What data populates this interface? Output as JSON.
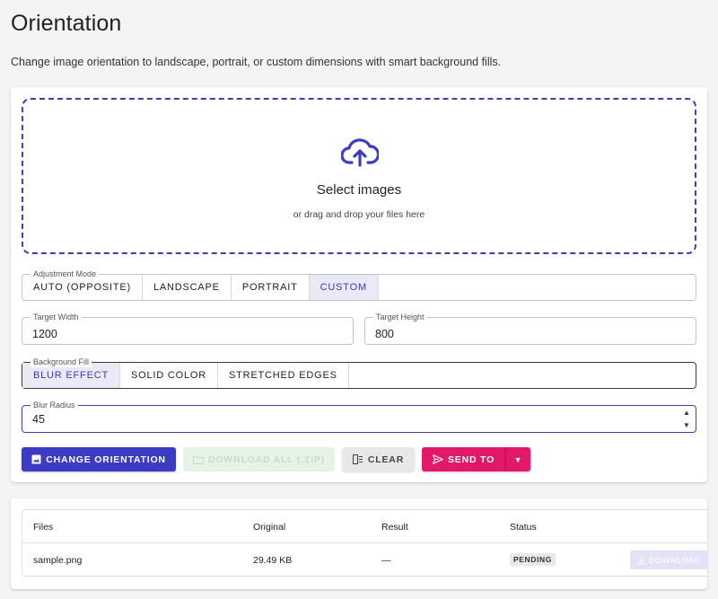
{
  "page": {
    "title": "Orientation",
    "description": "Change image orientation to landscape, portrait, or custom dimensions with smart background fills."
  },
  "dropzone": {
    "title": "Select images",
    "subtitle": "or drag and drop your files here",
    "icon": "cloud-upload-icon"
  },
  "adjustment_mode": {
    "label": "Adjustment Mode",
    "options": [
      "AUTO (OPPOSITE)",
      "LANDSCAPE",
      "PORTRAIT",
      "CUSTOM"
    ],
    "selected": "CUSTOM"
  },
  "target_width": {
    "label": "Target Width",
    "value": "1200"
  },
  "target_height": {
    "label": "Target Height",
    "value": "800"
  },
  "background_fill": {
    "label": "Background Fill",
    "options": [
      "BLUR EFFECT",
      "SOLID COLOR",
      "STRETCHED EDGES"
    ],
    "selected": "BLUR EFFECT"
  },
  "blur_radius": {
    "label": "Blur Radius",
    "value": "45"
  },
  "actions": {
    "change_orientation": "CHANGE ORIENTATION",
    "download_all": "DOWNLOAD ALL (.ZIP)",
    "clear": "CLEAR",
    "send_to": "SEND TO"
  },
  "files_table": {
    "headers": [
      "Files",
      "Original",
      "Result",
      "Status"
    ],
    "rows": [
      {
        "file": "sample.png",
        "original": "29.49 KB",
        "result": "—",
        "status": "PENDING",
        "action": "DOWNLOAD"
      }
    ]
  },
  "colors": {
    "accent": "#3b3bc4",
    "send_to": "#e0196a",
    "dropzone_border": "#3f3fb0"
  }
}
